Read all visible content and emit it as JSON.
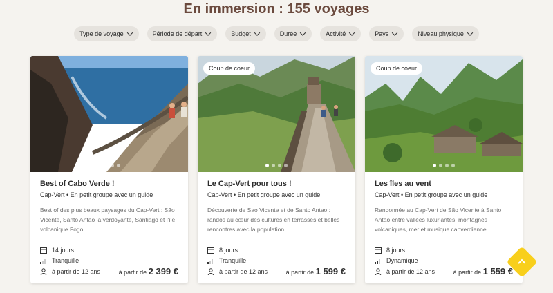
{
  "page": {
    "title": "En immersion : 155 voyages"
  },
  "filters": [
    {
      "label": "Type de voyage"
    },
    {
      "label": "Période de départ"
    },
    {
      "label": "Budget"
    },
    {
      "label": "Durée"
    },
    {
      "label": "Activité"
    },
    {
      "label": "Pays"
    },
    {
      "label": "Niveau physique"
    }
  ],
  "cards": [
    {
      "badge": "",
      "title": "Best of Cabo Verde !",
      "meta": "Cap-Vert • En petit groupe avec un guide",
      "description": "Best of des plus beaux paysages du Cap-Vert : São Vicente, Santo Antão la verdoyante, Santiago et l'île volcanique Fogo",
      "duration": "14 jours",
      "level": "Tranquille",
      "age": "à partir de 12 ans",
      "price_prefix": "à partir de",
      "price": "2 399 €"
    },
    {
      "badge": "Coup de coeur",
      "title": "Le Cap-Vert pour tous !",
      "meta": "Cap-Vert • En petit groupe avec un guide",
      "description": "Découverte de Sao Vicente et de Santo Antao : randos au cœur des cultures en terrasses et belles rencontres avec la population",
      "duration": "8 jours",
      "level": "Tranquille",
      "age": "à partir de 12 ans",
      "price_prefix": "à partir de",
      "price": "1 599 €"
    },
    {
      "badge": "Coup de coeur",
      "title": "Les îles au vent",
      "meta": "Cap-Vert • En petit groupe avec un guide",
      "description": "Randonnée au Cap-Vert de São Vicente à Santo Antão entre vallées luxuriantes, montagnes volcaniques, mer et musique capverdienne",
      "duration": "8 jours",
      "level": "Dynamique",
      "age": "à partir de 12 ans",
      "price_prefix": "à partir de",
      "price": "1 559 €"
    }
  ],
  "colors": {
    "title": "#6b4a3e",
    "accent": "#f8cf1c",
    "chip_bg": "#e6e3de"
  },
  "icons": [
    "calendar-icon",
    "level-bars-icon",
    "person-icon",
    "chevron-down-icon",
    "chevron-up-icon"
  ]
}
